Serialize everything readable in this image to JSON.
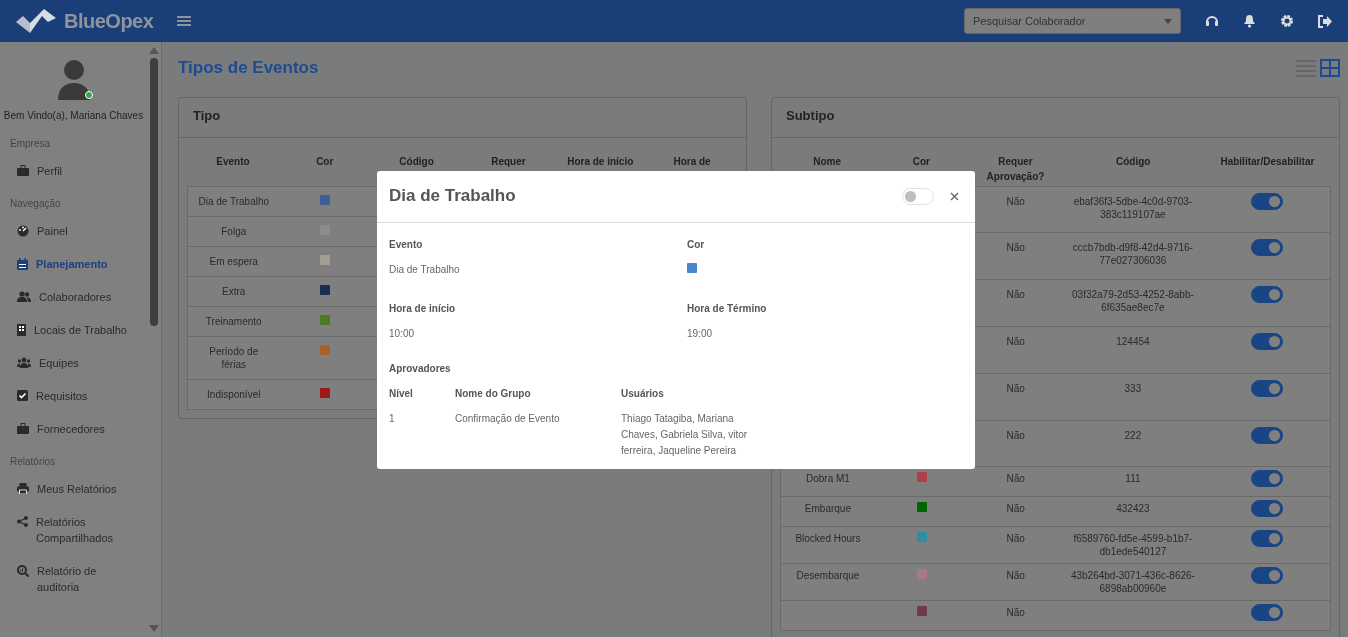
{
  "header": {
    "brand": "BlueOpex",
    "search": {
      "placeholder": "Pesquisar Colaborador"
    }
  },
  "sidebar": {
    "welcome": "Bem Vindo(a), Mariana Chaves",
    "online": true,
    "sections": [
      {
        "title": "Empresa",
        "items": [
          {
            "label": "Perfil",
            "selected": false
          }
        ]
      },
      {
        "title": "Navegação",
        "items": [
          {
            "label": "Painel",
            "selected": false
          },
          {
            "label": "Planejamento",
            "selected": true
          },
          {
            "label": "Colaboradores",
            "selected": false
          },
          {
            "label": "Locais de Trabalho",
            "selected": false
          },
          {
            "label": "Equipes",
            "selected": false
          },
          {
            "label": "Requisitos",
            "selected": false
          },
          {
            "label": "Fornecedores",
            "selected": false
          }
        ]
      },
      {
        "title": "Relatórios",
        "items": [
          {
            "label": "Meus Relatórios",
            "selected": false
          },
          {
            "label": "Relatórios Compartilhados",
            "selected": false
          },
          {
            "label": "Relatório de auditoria",
            "selected": false
          }
        ]
      }
    ]
  },
  "page": {
    "title": "Tipos de Eventos",
    "views": [
      {
        "selected": false
      },
      {
        "selected": true
      }
    ]
  },
  "tipo": {
    "title": "Tipo",
    "columns": [
      "Evento",
      "Cor",
      "Código",
      "Requer",
      "Hora de início",
      "Hora de"
    ],
    "rows": [
      {
        "evento": "Dia de Trabalho",
        "color": "#3f5f92"
      },
      {
        "evento": "Folga",
        "color": "#8c8c8c"
      },
      {
        "evento": "Em espera",
        "color": "#a39d92"
      },
      {
        "evento": "Extra",
        "color": "#1a2e50"
      },
      {
        "evento": "Treinamento",
        "color": "#4f7a25"
      },
      {
        "evento": "Período de férias",
        "color": "#a8602a"
      },
      {
        "evento": "Indisponível",
        "color": "#a01818"
      }
    ]
  },
  "subtipo": {
    "title": "Subtipo",
    "columns": [
      "Nome",
      "Cor",
      "Requer Aprovação?",
      "Código",
      "Habilitar/Desabilitar"
    ],
    "rows": [
      {
        "requer": "Não",
        "codigo": "ebaf36f3-5dbe-4c0d-9703-383c119107ae",
        "enabled": true
      },
      {
        "requer": "Não",
        "codigo": "cccb7bdb-d9f8-42d4-9716-77e027306036",
        "enabled": true
      },
      {
        "requer": "Não",
        "codigo": "03f32a79-2d53-4252-8abb-6f635ae8ec7e",
        "enabled": true
      },
      {
        "requer": "Não",
        "codigo": "124454",
        "enabled": true
      },
      {
        "requer": "Não",
        "codigo": "333",
        "enabled": true
      },
      {
        "requer": "Não",
        "codigo": "222",
        "enabled": true
      },
      {
        "nome": "Dobra M1",
        "color": "#b04048",
        "requer": "Não",
        "codigo": "111",
        "enabled": true
      },
      {
        "nome": "Embarque",
        "color": "#006600",
        "requer": "Não",
        "codigo": "432423",
        "enabled": true
      },
      {
        "nome": "Blocked Hours",
        "color": "#2e8ca5",
        "requer": "Não",
        "codigo": "f6589760-fd5e-4599-b1b7-db1ede540127",
        "enabled": true
      },
      {
        "nome": "Desembarque",
        "color": "#a87a84",
        "requer": "Não",
        "codigo": "43b264bd-3071-436c-8626-6898ab00960e",
        "enabled": true
      },
      {
        "color": "#6e3c48",
        "requer": "Não",
        "enabled": true
      }
    ]
  },
  "modal": {
    "title": "Dia de Trabalho",
    "enabled": false,
    "fields": [
      {
        "label": "Evento",
        "value": "Dia de Trabalho"
      },
      {
        "label": "Cor",
        "color": "#4a86d0"
      },
      {
        "label": "Hora de início",
        "value": "10:00"
      },
      {
        "label": "Hora de Término",
        "value": "19:00"
      }
    ],
    "approvers": {
      "title": "Aprovadores",
      "columns": [
        "Nível",
        "Nome do Grupo",
        "Usuários"
      ],
      "rows": [
        {
          "nivel": "1",
          "grupo": "Confirmação de Evento",
          "usuarios": "Thiago Tatagiba, Mariana Chaves, Gabriela Silva, vitor ferreira, Jaqueline Pereira"
        }
      ]
    }
  }
}
